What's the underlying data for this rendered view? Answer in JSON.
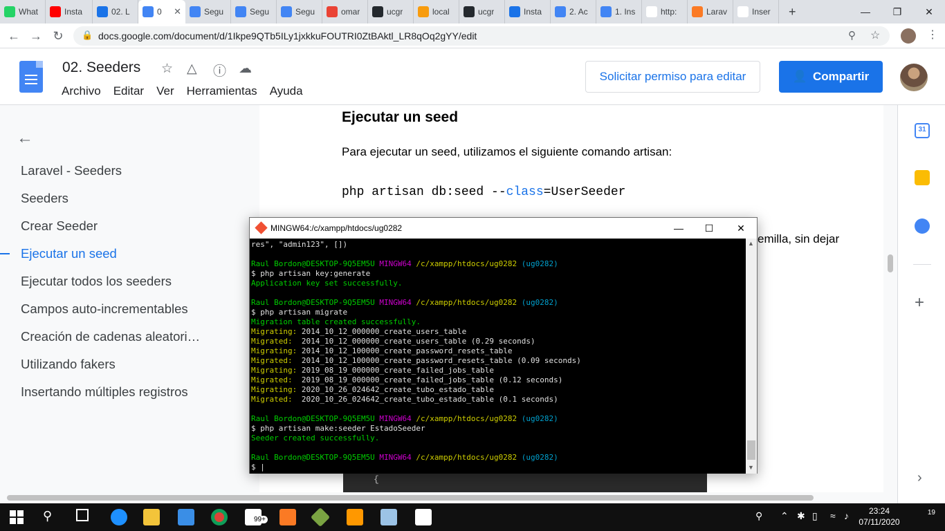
{
  "browser": {
    "tabs": [
      {
        "label": "What",
        "icon": "whatsapp-icon",
        "color": "#25d366"
      },
      {
        "label": "Insta",
        "icon": "youtube-icon",
        "color": "#ff0000"
      },
      {
        "label": "02. L",
        "icon": "contact-icon",
        "color": "#1a73e8"
      },
      {
        "label": "0",
        "icon": "docs-icon",
        "color": "#4285f4",
        "active": true
      },
      {
        "label": "Segu",
        "icon": "docs-icon",
        "color": "#4285f4"
      },
      {
        "label": "Segu",
        "icon": "docs-icon",
        "color": "#4285f4"
      },
      {
        "label": "Segu",
        "icon": "docs-icon",
        "color": "#4285f4"
      },
      {
        "label": "omar",
        "icon": "gmail-icon",
        "color": "#ea4335"
      },
      {
        "label": "ucgr",
        "icon": "github-icon",
        "color": "#24292e"
      },
      {
        "label": "local",
        "icon": "phpmyadmin-icon",
        "color": "#f89c0e"
      },
      {
        "label": "ucgr",
        "icon": "github-icon",
        "color": "#24292e"
      },
      {
        "label": "Insta",
        "icon": "contact-icon",
        "color": "#1a73e8"
      },
      {
        "label": "2. Ac",
        "icon": "docs-icon",
        "color": "#4285f4"
      },
      {
        "label": "1. Ins",
        "icon": "docs-icon",
        "color": "#4285f4"
      },
      {
        "label": "http:",
        "icon": "google-icon",
        "color": "#ffffff"
      },
      {
        "label": "Larav",
        "icon": "xampp-icon",
        "color": "#fb7a24"
      },
      {
        "label": "Inser",
        "icon": "laravel-icon",
        "color": "#ffffff"
      }
    ],
    "new_tab": "+",
    "url": "docs.google.com/document/d/1Ikpe9QTb5ILy1jxkkuFOUTRI0ZtBAktl_LR8qOq2gYY/edit"
  },
  "docs": {
    "title": "02. Seeders",
    "menu": [
      "Archivo",
      "Editar",
      "Ver",
      "Herramientas",
      "Ayuda"
    ],
    "request_edit": "Solicitar permiso para editar",
    "share": "Compartir",
    "calendar_day": "31"
  },
  "outline": {
    "items": [
      "Laravel - Seeders",
      "Seeders",
      "Crear Seeder",
      "Ejecutar un seed",
      "Ejecutar todos los seeders",
      "Campos auto-incrementables",
      "Creación de cadenas aleatori…",
      "Utilizando fakers",
      "Insertando múltiples registros"
    ],
    "active_index": 3
  },
  "document": {
    "heading": "Ejecutar un seed",
    "para1": "Para ejecutar un seed, utilizamos el siguiente comando artisan:",
    "code_prefix": "php artisan db:seed --",
    "code_kw": "class",
    "code_suffix": "=UserSeeder",
    "para2_tail": "emilla, sin dejar",
    "code_block_line": "{"
  },
  "terminal": {
    "title": "MINGW64:/c/xampp/htdocs/ug0282",
    "prompt_user": "Raul Bordon@DESKTOP-9Q5EM5U",
    "prompt_shell": "MINGW64",
    "prompt_path": "/c/xampp/htdocs/ug0282",
    "prompt_branch": "(ug0282)",
    "top_line": "res\", \"admin123\", [])",
    "cmd1": "$ php artisan key:generate",
    "out1": "Application key set successfully.",
    "cmd2": "$ php artisan migrate",
    "out2": "Migration table created successfully.",
    "migrations": [
      [
        "Migrating:",
        "2014_10_12_000000_create_users_table"
      ],
      [
        "Migrated: ",
        "2014_10_12_000000_create_users_table (0.29 seconds)"
      ],
      [
        "Migrating:",
        "2014_10_12_100000_create_password_resets_table"
      ],
      [
        "Migrated: ",
        "2014_10_12_100000_create_password_resets_table (0.09 seconds)"
      ],
      [
        "Migrating:",
        "2019_08_19_000000_create_failed_jobs_table"
      ],
      [
        "Migrated: ",
        "2019_08_19_000000_create_failed_jobs_table (0.12 seconds)"
      ],
      [
        "Migrating:",
        "2020_10_26_024642_create_tubo_estado_table"
      ],
      [
        "Migrated: ",
        "2020_10_26_024642_create_tubo_estado_table (0.1 seconds)"
      ]
    ],
    "cmd3": "$ php artisan make:seeder EstadoSeeder",
    "out3": "Seeder created successfully.",
    "cursor_line": "$ |"
  },
  "taskbar": {
    "time": "23:24",
    "date": "07/11/2020",
    "notifications": "19",
    "badge_count": "99+"
  }
}
